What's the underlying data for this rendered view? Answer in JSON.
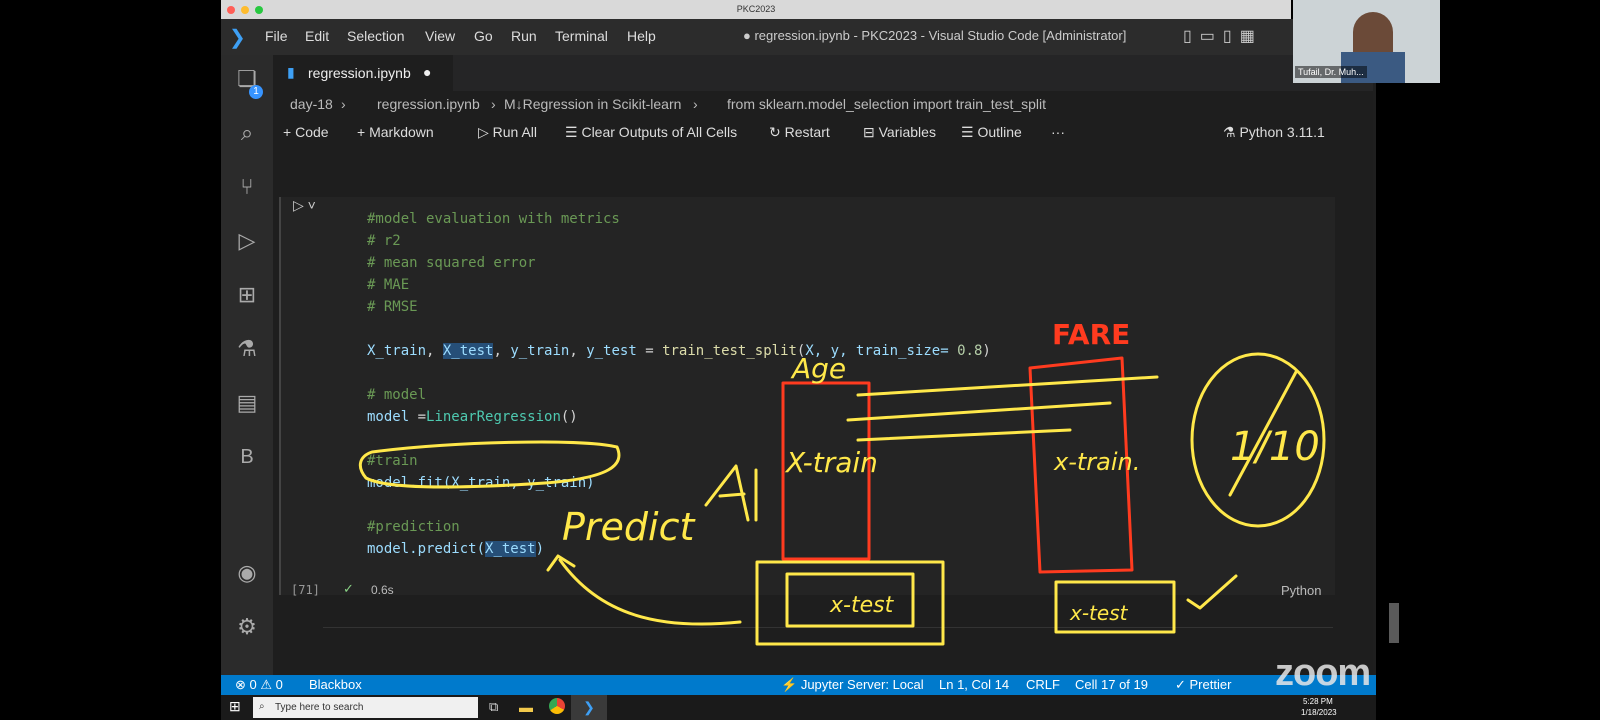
{
  "mac_window_title": "PKC2023",
  "menu": [
    "File",
    "Edit",
    "Selection",
    "View",
    "Go",
    "Run",
    "Terminal",
    "Help"
  ],
  "window_title": "● regression.ipynb - PKC2023 - Visual Studio Code [Administrator]",
  "explorer_badge": "1",
  "tab": {
    "label": "regression.ipynb",
    "modified": "●"
  },
  "breadcrumb": {
    "folder": "day-18",
    "file": "regression.ipynb",
    "section": "M↓Regression in Scikit-learn",
    "symbol": "from sklearn.model_selection import train_test_split"
  },
  "toolbar": {
    "code": "Code",
    "markdown": "Markdown",
    "run_all": "Run All",
    "clear": "Clear Outputs of All Cells",
    "restart": "Restart",
    "variables": "Variables",
    "outline": "Outline",
    "more": "···",
    "kernel": "Python 3.11.1"
  },
  "code_lines": {
    "c1": "#model evaluation with metrics",
    "c2": "# r2",
    "c3": "# mean squared error",
    "c4": "# MAE",
    "c5": "# RMSE",
    "l_split_a": "X_train",
    "l_split_b": "X_test",
    "l_split_c": "y_train",
    "l_split_d": "y_test",
    "l_split_fn": "train_test_split",
    "l_split_args": "X, y, train_size=",
    "l_split_num": "0.8",
    "c_model": "# model",
    "model_var": "model",
    "model_cls": "LinearRegression",
    "c_train": "#train",
    "fit_line": "model.fit(X_train, y_train)",
    "c_pred": "#prediction",
    "pred_a": "model.predict(",
    "pred_b": "X_test",
    "pred_c": ")"
  },
  "cell_status": {
    "exec_count": "[71]",
    "time": "0.6s",
    "language": "Python"
  },
  "statusbar": {
    "errors": "0",
    "warnings": "0",
    "ext": "Blackbox",
    "jupyter": "Jupyter Server: Local",
    "position": "Ln 1, Col 14",
    "eol": "CRLF",
    "cell": "Cell 17 of 19",
    "prettier": "Prettier"
  },
  "taskbar": {
    "search": "Type here to search",
    "time": "5:28 PM",
    "date": "1/18/2023"
  },
  "webcam": {
    "participant": "Tufail, Dr. Muh..."
  },
  "zoom_logo": "zoom",
  "annotations": {
    "fare": "FARE",
    "age": "Age",
    "x_train_left": "X-train",
    "x_train_right": "x-train.",
    "x_test_left": "x-test",
    "x_test_right": "x-test",
    "predict": "Predict",
    "fraction": "1/10"
  },
  "colors": {
    "ink_yellow": "#ffe84a",
    "ink_red": "#ff3b1f",
    "status_blue": "#007acc"
  }
}
